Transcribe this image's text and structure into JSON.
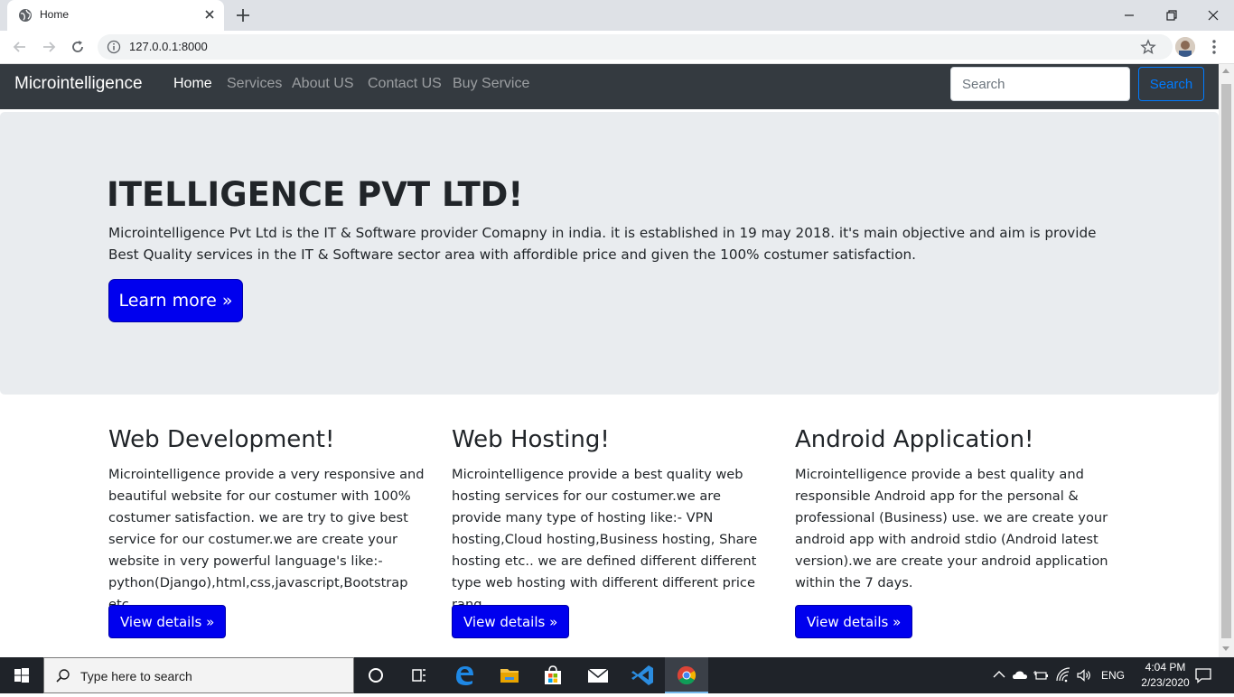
{
  "browser": {
    "tab_title": "Home",
    "url": "127.0.0.1:8000"
  },
  "navbar": {
    "brand": "Microintelligence",
    "links": [
      {
        "label": "Home",
        "active": true
      },
      {
        "label": "Services"
      },
      {
        "label": "About US"
      },
      {
        "label": "Contact US"
      },
      {
        "label": "Buy Service"
      }
    ],
    "search_placeholder": "Search",
    "search_button": "Search"
  },
  "jumbotron": {
    "title": "ITELLIGENCE PVT LTD!",
    "text": "Microintelligence Pvt Ltd is the IT & Software provider Comapny in india. it is established in 19 may 2018. it's main objective and aim is provide Best Quality services in the IT & Software sector area with affordible price and given the 100% costumer satisfaction.",
    "button": "Learn more »"
  },
  "columns": [
    {
      "heading": "Web Development!",
      "text": "Microintelligence provide a very responsive and beautiful website for our costumer with 100% costumer satisfaction. we are try to give best service for our costumer.we are create your website in very powerful language's like:- python(Django),html,css,javascript,Bootstrap etc..",
      "button": "View details »"
    },
    {
      "heading": "Web Hosting!",
      "text": "Microintelligence provide a best quality web hosting services for our costumer.we are provide many type of hosting like:- VPN hosting,Cloud hosting,Business hosting, Share hosting etc.. we are defined different different type web hosting with different different price rang.",
      "button": "View details »"
    },
    {
      "heading": "Android Application!",
      "text": "Microintelligence provide a best quality and responsible Android app for the personal & professional (Business) use. we are create your android app with android stdio (Android latest version).we are create your android application within the 7 days.",
      "button": "View details »"
    }
  ],
  "taskbar": {
    "search_placeholder": "Type here to search",
    "language": "ENG",
    "time": "4:04 PM",
    "date": "2/23/2020"
  },
  "colors": {
    "navbar_bg": "#343a40",
    "jumbotron_bg": "#e9ecef",
    "button_blue": "#0000ee",
    "outline_blue": "#007bff",
    "taskbar_bg": "#1f2329"
  }
}
